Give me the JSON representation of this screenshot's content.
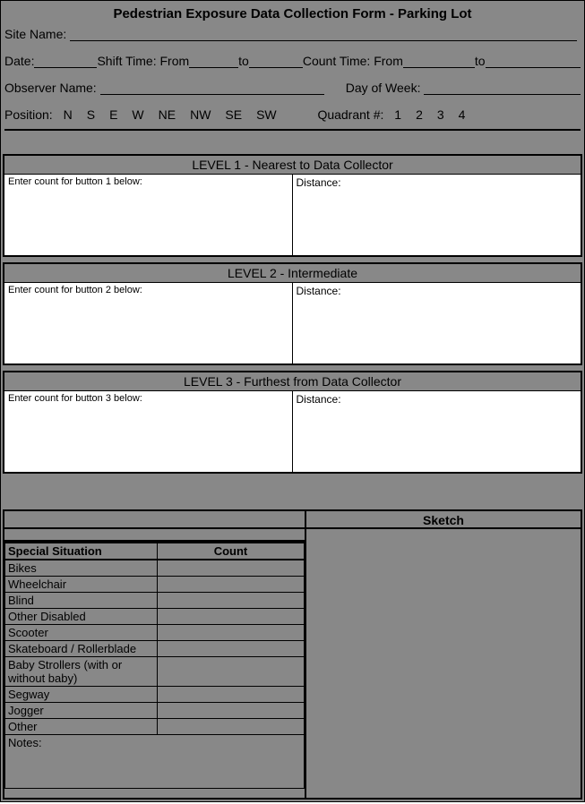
{
  "title": "Pedestrian Exposure Data Collection Form - Parking Lot",
  "fields": {
    "site_name_label": "Site Name:",
    "date_label": "Date:",
    "shift_time_label": "Shift Time: From",
    "to_label": "to",
    "count_time_label": "Count Time: From",
    "observer_label": "Observer Name:",
    "dow_label": "Day of Week:",
    "position_label": "Position:",
    "quadrant_label": "Quadrant #:"
  },
  "positions": [
    "N",
    "S",
    "E",
    "W",
    "NE",
    "NW",
    "SE",
    "SW"
  ],
  "quadrants": [
    "1",
    "2",
    "3",
    "4"
  ],
  "levels": [
    {
      "header": "LEVEL 1 - Nearest to Data Collector",
      "left": "Enter count for button 1 below:",
      "right": "Distance:"
    },
    {
      "header": "LEVEL 2 - Intermediate",
      "left": "Enter count for button 2 below:",
      "right": "Distance:"
    },
    {
      "header": "LEVEL 3 - Furthest from Data Collector",
      "left": "Enter count for button 3 below:",
      "right": "Distance:"
    }
  ],
  "sketch_label": "Sketch",
  "ss_header": {
    "col1": "Special Situation",
    "col2": "Count"
  },
  "ss_rows": [
    "Bikes",
    "Wheelchair",
    "Blind",
    "Other Disabled",
    "Scooter",
    "Skateboard / Rollerblade",
    "Baby Strollers (with or without baby)",
    "Segway",
    "Jogger",
    "Other"
  ],
  "notes_label": "Notes:"
}
